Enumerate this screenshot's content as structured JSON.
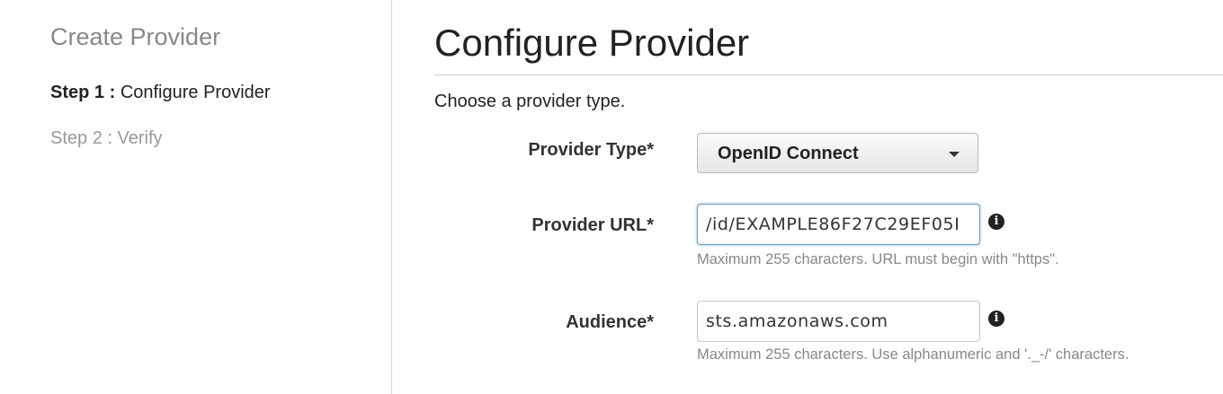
{
  "wizard": {
    "title": "Create Provider",
    "steps": [
      {
        "number": "Step 1 :",
        "label": "Configure Provider",
        "active": true
      },
      {
        "number": "Step 2 :",
        "label": "Verify",
        "active": false
      }
    ]
  },
  "main": {
    "title": "Configure Provider",
    "instructions": "Choose a provider type.",
    "fields": {
      "provider_type": {
        "label": "Provider Type*",
        "value": "OpenID Connect"
      },
      "provider_url": {
        "label": "Provider URL*",
        "value": "/id/EXAMPLE86F27C29EF05I",
        "help": "Maximum 255 characters. URL must begin with \"https\"."
      },
      "audience": {
        "label": "Audience*",
        "value": "sts.amazonaws.com",
        "help": "Maximum 255 characters. Use alphanumeric and '._-/' characters."
      }
    }
  },
  "icons": {
    "info": "info-icon",
    "dropdown": "chevron-down-icon"
  },
  "colors": {
    "focus_border": "#5b9dd9",
    "muted_text": "#888888"
  }
}
